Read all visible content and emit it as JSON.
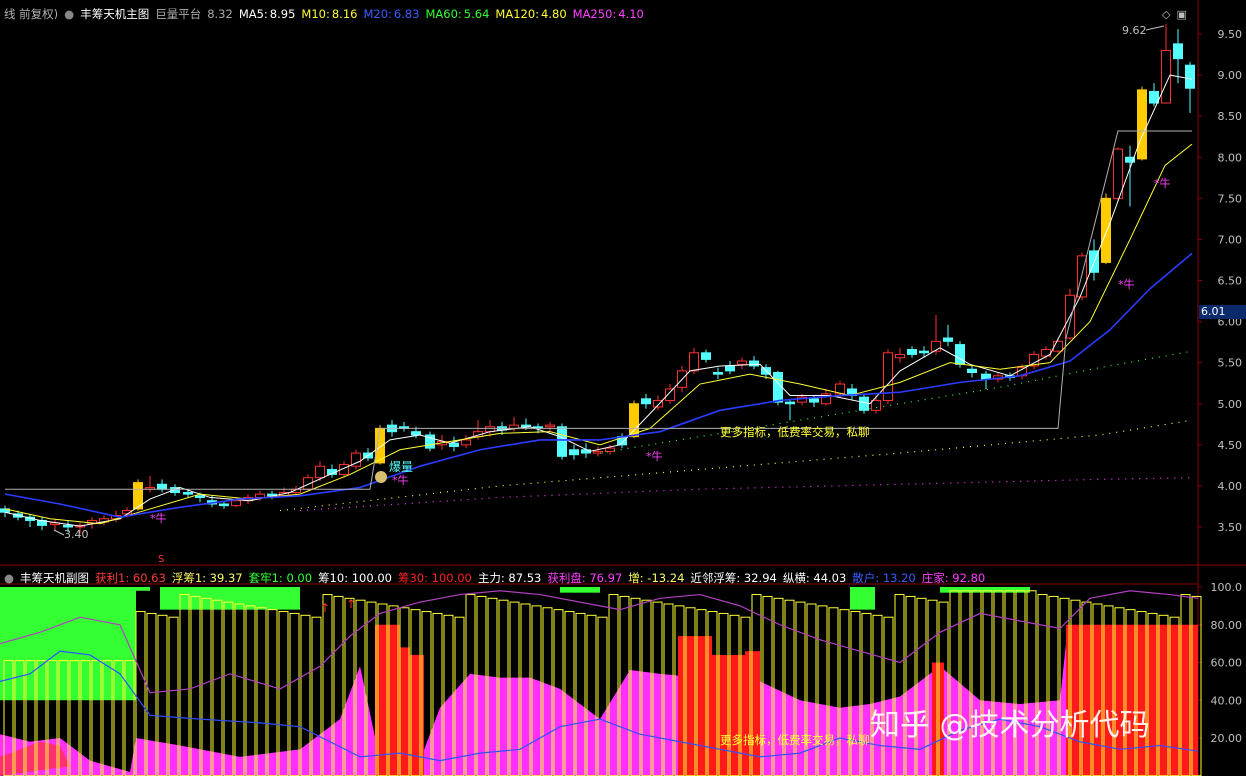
{
  "main_header": {
    "title": "线 前复权)",
    "indicator": "丰筹天机主图",
    "platform_label": "巨量平台",
    "platform_value": "8.32",
    "ma5_label": "MA5:",
    "ma5_value": "8.95",
    "m10_label": "M10:",
    "m10_value": "8.16",
    "m20_label": "M20:",
    "m20_value": "6.83",
    "ma60_label": "MA60:",
    "ma60_value": "5.64",
    "ma120_label": "MA120:",
    "ma120_value": "4.80",
    "ma250_label": "MA250:",
    "ma250_value": "4.10"
  },
  "sub_header": {
    "title": "丰筹天机副图",
    "items": [
      {
        "label": "获利1:",
        "value": "60.63",
        "color": "#ff3b3b"
      },
      {
        "label": "浮筹1:",
        "value": "39.37",
        "color": "#ffff66"
      },
      {
        "label": "套牢1:",
        "value": "0.00",
        "color": "#33ff33"
      },
      {
        "label": "筹10:",
        "value": "100.00",
        "color": "#ffffff"
      },
      {
        "label": "筹30:",
        "value": "100.00",
        "color": "#ff2020"
      },
      {
        "label": "主力:",
        "value": "87.53",
        "color": "#ffffff"
      },
      {
        "label": "获利盘:",
        "value": "76.97",
        "color": "#ff40ff"
      },
      {
        "label": "增:",
        "value": "-13.24",
        "color": "#ffff66"
      },
      {
        "label": "近邻浮筹:",
        "value": "32.94",
        "color": "#ffffff"
      },
      {
        "label": "纵横:",
        "value": "44.03",
        "color": "#ffffff"
      },
      {
        "label": "散户:",
        "value": "13.20",
        "color": "#3b5bff"
      },
      {
        "label": "庄家:",
        "value": "92.80",
        "color": "#ff40ff"
      }
    ]
  },
  "price_axis": [
    "9.50",
    "9.00",
    "8.50",
    "8.00",
    "7.50",
    "7.00",
    "6.50",
    "6.00",
    "5.50",
    "5.00",
    "4.50",
    "4.00",
    "3.50"
  ],
  "sub_axis": [
    "100.0",
    "80.00",
    "60.00",
    "40.00",
    "20.00"
  ],
  "current_price_tag": "6.01",
  "annotations": {
    "high_label": "9.62",
    "low_label": "3.40",
    "volume_label": "爆量",
    "star_label": "牛",
    "promo_text_main": "更多指标，低费率交易，私聊",
    "promo_text_sub": "更多指标，低费率交易，私聊",
    "sub_marker": "S"
  },
  "watermark": "知乎 @技术分析代码",
  "colors": {
    "up": "#ff3030",
    "down": "#54ffff",
    "yellow_bar": "#ffcc00",
    "ma5": "#ffffff",
    "m10": "#ffff00",
    "m20": "#2a3cff",
    "magenta": "#ff30ff",
    "green_fill": "#33ff33",
    "red_fill": "#ff1a1a"
  }
}
